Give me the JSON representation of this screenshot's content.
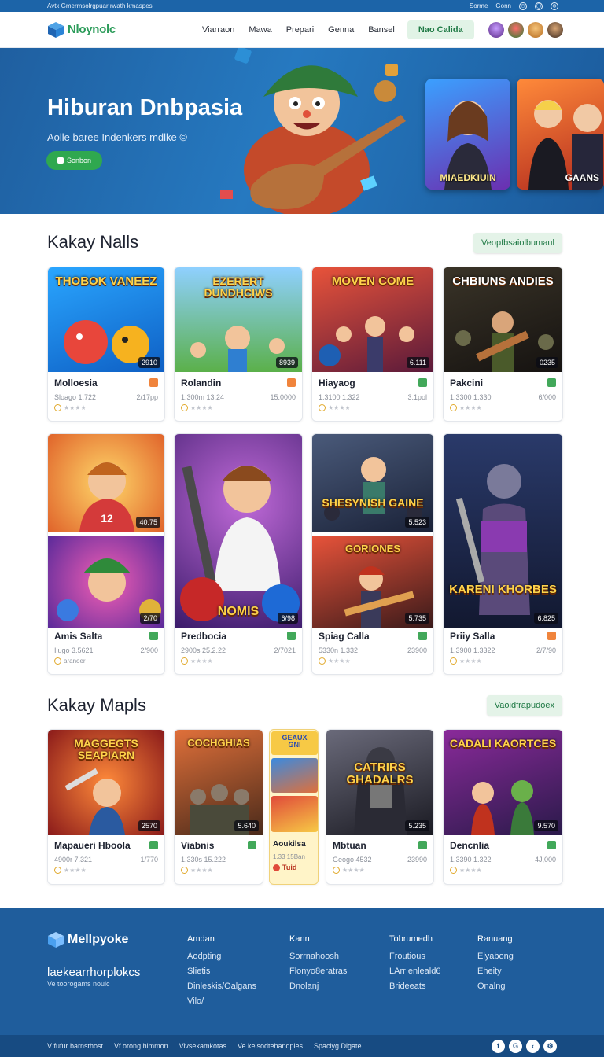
{
  "topbar": {
    "left_text": "Avtx Gmermsolrgpuar rwath kmaspes",
    "right_items": [
      "Sorme",
      "Gonn"
    ]
  },
  "header": {
    "logo_text": "Nloynolc",
    "nav": [
      "Viarraon",
      "Mawa",
      "Prepari",
      "Genna",
      "Bansel"
    ],
    "cta": "Nao Calida"
  },
  "hero": {
    "title": "Hiburan Dnbpasia",
    "subtitle": "Aolle baree Indenkers mdlke ©",
    "button": "Sonbon",
    "card1_caption": "MIAEDKIUIN",
    "card2_caption": "GAANS"
  },
  "section1": {
    "title": "Kakay Nalls",
    "button": "Veopfbsaiolbumaul",
    "cards": [
      {
        "art": "THOBOK VANEEZ",
        "badge": "2910",
        "name": "Molloesia",
        "meta_left": "Sloago 1.722",
        "meta_right": "2/17pp",
        "tag": "orange"
      },
      {
        "art": "EZERERT DUNDHCIWS",
        "badge": "8939",
        "name": "Rolandin",
        "meta_left": "1.300m 13.24",
        "meta_right": "15.0000",
        "tag": "orange"
      },
      {
        "art": "MOVEN COME",
        "badge": "6.111",
        "name": "Hiayaog",
        "meta_left": "1.3100 1.322",
        "meta_right": "3.1pol",
        "tag": "green"
      },
      {
        "art": "CHBIUNS ANDIES",
        "badge": "0235",
        "name": "Pakcini",
        "meta_left": "1.3300 1.330",
        "meta_right": "6/000",
        "tag": "green"
      }
    ]
  },
  "section2": {
    "cards": [
      {
        "art_top": "12",
        "badge_top": "40.75",
        "badge": "2/70",
        "name": "Amis Salta",
        "meta_left": "Ilugo 3.5621",
        "meta_right": "2/900",
        "sub": "aranoer",
        "tag": "green"
      },
      {
        "art": "NOMIS",
        "badge": "6/98",
        "name": "Predbocia",
        "meta_left": "2900s 25.2.22",
        "meta_right": "2/7021",
        "tag": "green"
      },
      {
        "art_top": "SHESYNISH GAINE",
        "badge_top": "5.523",
        "art": "GORIONES",
        "badge": "5.735",
        "name": "Spiag Calla",
        "meta_left": "5330n 1.332",
        "meta_right": "23900",
        "tag": "green"
      },
      {
        "art": "KARENI KHORBES",
        "badge": "6.825",
        "name": "Priiy Salla",
        "meta_left": "1.3900 1.3322",
        "meta_right": "2/7/90",
        "tag": "orange"
      }
    ]
  },
  "section3": {
    "title": "Kakay Mapls",
    "button": "Vaoidfrapudoex",
    "cards": [
      {
        "art": "MAGGEGTS SEAPIARN",
        "badge": "2570",
        "name": "Mapaueri Hboola",
        "meta_left": "4900r 7.321",
        "meta_right": "1/770",
        "tag": "green"
      },
      {
        "art": "COCHGHIAS",
        "badge": "5.640",
        "name": "Viabnis",
        "meta_left": "1.330s 15.222",
        "meta_right": "",
        "tag": "green"
      },
      {
        "small_art": [
          "GEAUX GNI",
          "",
          ""
        ],
        "name": "Aoukilsa",
        "meta_left": "1.33 15Ban",
        "sub": "Tuid"
      },
      {
        "art": "CATRIRS GHADALRS",
        "badge": "5.235",
        "name": "Mbtuan",
        "meta_left": "Geogo 4532",
        "meta_right": "23990",
        "tag": "green"
      },
      {
        "art": "CADALI KAORTCES",
        "badge": "9.570",
        "name": "Dencnlia",
        "meta_left": "1.3390 1.322",
        "meta_right": "4J,000",
        "tag": "green"
      }
    ]
  },
  "footer": {
    "logo": "Mellpyoke",
    "tagline": "laekearrhorplokcs",
    "small": "Ve toorogams noulc",
    "col1": [
      "Amdan",
      "Aodpting",
      "Slietis",
      "Dinleskis/Oalgans",
      "Vilo/"
    ],
    "col2": [
      "Kann",
      "Sorrnahoosh",
      "Flonyo8eratras",
      "Dnolanj"
    ],
    "col3": [
      "Tobrumedh",
      "Froutious",
      "LArr enleald6",
      "Brideeats"
    ],
    "col4": [
      "Ranuang",
      "Elyabong",
      "Eheity",
      "Onalng"
    ],
    "bottom": [
      "V fufur barnsthost",
      "Vf orong hlmmon",
      "Vivsekamkotas",
      "Ve kelsodtehanqples",
      "Spaciyg Digate"
    ]
  }
}
